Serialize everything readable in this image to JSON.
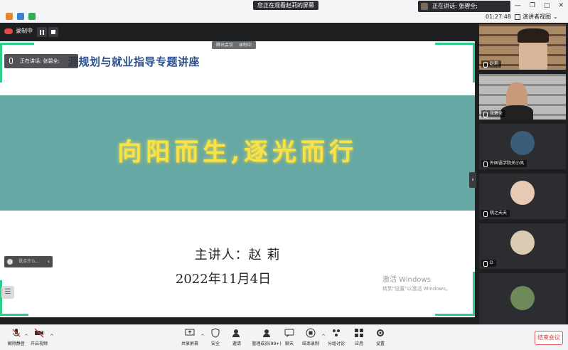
{
  "titlebar": {
    "viewing_text": "您正在观看赵莉的屏幕",
    "speaker_text": "正在讲话: 张碧全;",
    "timer": "01:27:48",
    "view_mode": "演讲者视图"
  },
  "recording": {
    "label": "录制中"
  },
  "mini_toolbar": {
    "items": [
      "腾讯会议",
      "录制中"
    ]
  },
  "slide": {
    "speaker_overlay": "正在讲话: 张碧全;",
    "title": "涯规划与就业指导专题讲座",
    "banner": "向阳而生,逐光而行",
    "presenter": "主讲人：赵 莉",
    "date": "2022年11月4日",
    "activate_line1": "激活 Windows",
    "activate_line2": "转到\"设置\"以激活 Windows。",
    "chat_tip": "说点什么..."
  },
  "participants": [
    {
      "name": "赵莉"
    },
    {
      "name": "张碧全"
    },
    {
      "name": "外国语学院关小凤"
    },
    {
      "name": "桃之夭夭"
    },
    {
      "name": "D"
    },
    {
      "name": ""
    }
  ],
  "toolbar": {
    "mute": "解除静音",
    "video": "开启视频",
    "share": "共享屏幕",
    "security": "安全",
    "invite": "邀请",
    "members": "管理成员(99+)",
    "chat": "聊天",
    "end_record": "结束录制",
    "breakout": "分组讨论",
    "apps": "应用",
    "settings": "设置",
    "end_meeting": "结束会议"
  },
  "colors": {
    "banner_bg": "#66a8a3",
    "banner_text": "#f4e44a",
    "title_text": "#2c4f8e",
    "corner_accent": "#2ad08a",
    "end_button": "#e03a3a"
  }
}
